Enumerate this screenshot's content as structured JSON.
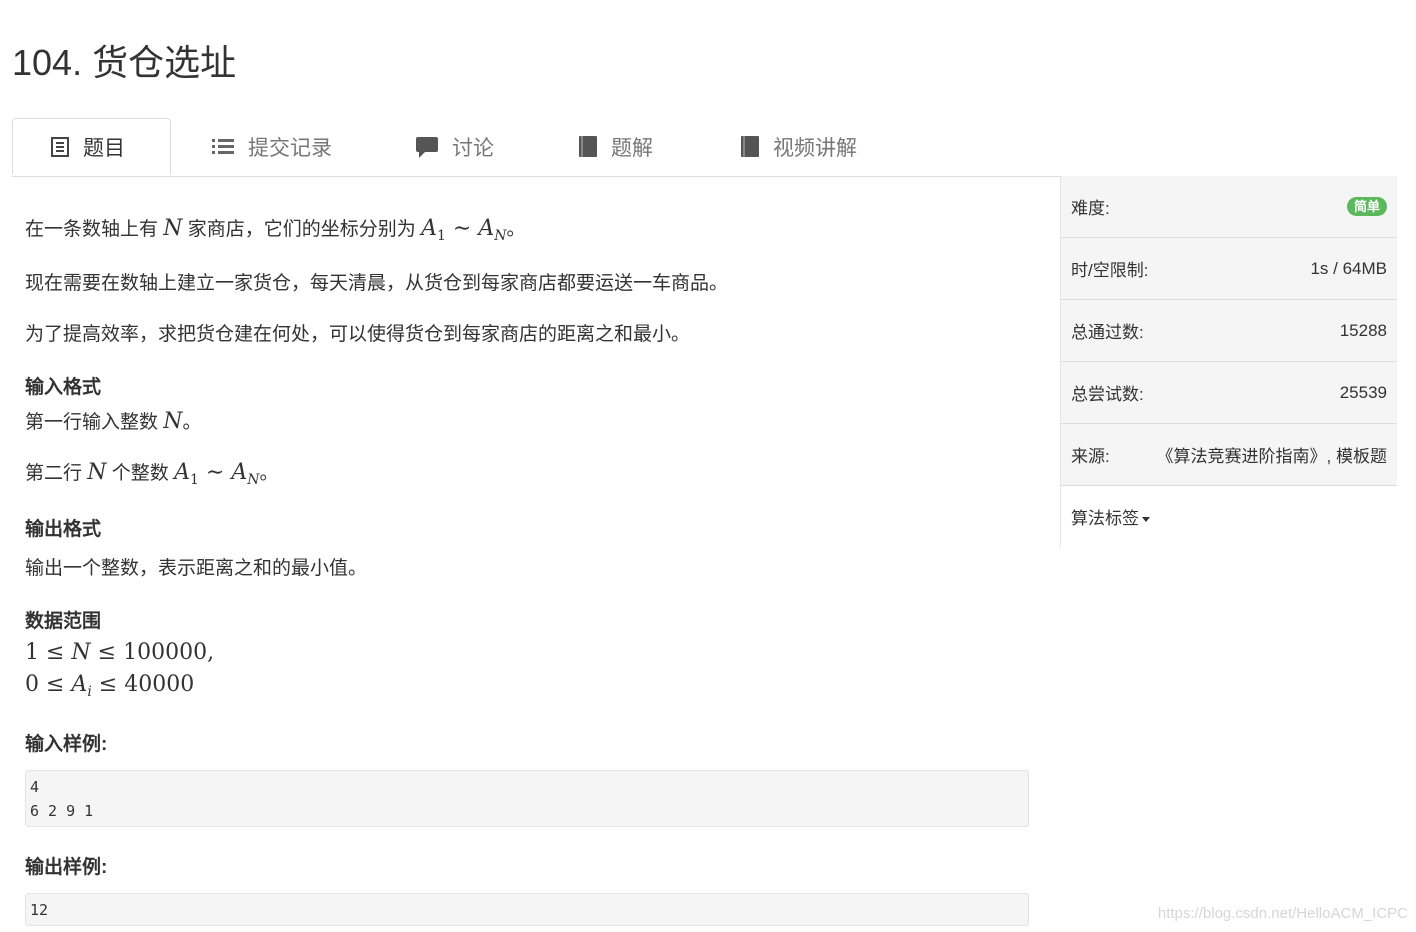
{
  "page_title": "104. 货仓选址",
  "tabs": [
    {
      "label": "题目",
      "icon": "list-alt-icon"
    },
    {
      "label": "提交记录",
      "icon": "list-icon"
    },
    {
      "label": "讨论",
      "icon": "comment-icon"
    },
    {
      "label": "题解",
      "icon": "book-icon"
    },
    {
      "label": "视频讲解",
      "icon": "book-icon"
    }
  ],
  "problem": {
    "p1": {
      "a": "在一条数轴上有 ",
      "N": "N",
      "b": " 家商店，它们的坐标分别为 ",
      "A": "A",
      "s1": "1",
      "tilde": " ∼ ",
      "A2": "A",
      "sN": "N",
      "end": "。"
    },
    "p2": "现在需要在数轴上建立一家货仓，每天清晨，从货仓到每家商店都要运送一车商品。",
    "p3": "为了提高效率，求把货仓建在何处，可以使得货仓到每家商店的距离之和最小。",
    "input_heading": "输入格式",
    "input_line1": {
      "a": "第一行输入整数 ",
      "N": "N",
      "end": "。"
    },
    "input_line2": {
      "a": "第二行 ",
      "N": "N",
      "b": " 个整数 ",
      "A": "A",
      "s1": "1",
      "tilde": " ∼ ",
      "A2": "A",
      "sN": "N",
      "end": "。"
    },
    "output_heading": "输出格式",
    "output_text": "输出一个整数，表示距离之和的最小值。",
    "range_heading": "数据范围",
    "range_line1": {
      "one": "1",
      "le1": " ≤ ",
      "N": "N",
      "le2": " ≤ ",
      "max": "100000",
      "comma": ","
    },
    "range_line2": {
      "zero": "0",
      "le1": " ≤ ",
      "A": "A",
      "i": "i",
      "le2": " ≤ ",
      "max": "40000"
    },
    "sample_input_heading": "输入样例:",
    "sample_input": "4\n6 2 9 1",
    "sample_output_heading": "输出样例:",
    "sample_output": "12"
  },
  "sidebar": {
    "difficulty_label": "难度:",
    "difficulty_value": "简单",
    "difficulty_color": "#5cb85c",
    "limit_label": "时/空限制:",
    "limit_value": "1s / 64MB",
    "passed_label": "总通过数:",
    "passed_value": "15288",
    "tried_label": "总尝试数:",
    "tried_value": "25539",
    "source_label": "来源:",
    "source_value": "《算法竞赛进阶指南》, 模板题",
    "tags_label": "算法标签"
  },
  "watermark": "https://blog.csdn.net/HelloACM_ICPC"
}
